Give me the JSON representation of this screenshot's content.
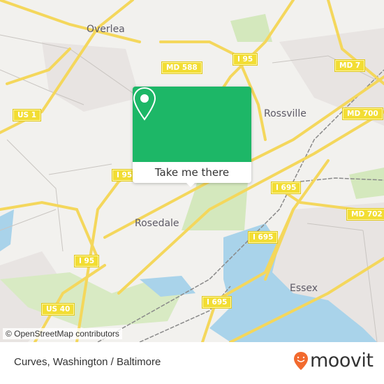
{
  "map": {
    "places": [
      {
        "name": "Overlea",
        "id": "overlea"
      },
      {
        "name": "Rossville",
        "id": "rossville"
      },
      {
        "name": "Rosedale",
        "id": "rosedale"
      },
      {
        "name": "Essex",
        "id": "essex"
      }
    ],
    "shields": [
      {
        "label": "MD 588",
        "id": "md-588"
      },
      {
        "label": "I 95",
        "id": "i-95-north"
      },
      {
        "label": "MD 7",
        "id": "md-7"
      },
      {
        "label": "US 1",
        "id": "us-1"
      },
      {
        "label": "MD 700",
        "id": "md-700"
      },
      {
        "label": "I 95",
        "id": "i-95-mid"
      },
      {
        "label": "I 695",
        "id": "i-695-east"
      },
      {
        "label": "MD 702",
        "id": "md-702"
      },
      {
        "label": "I 695",
        "id": "i-695-mid"
      },
      {
        "label": "I 95",
        "id": "i-95-south"
      },
      {
        "label": "US 40",
        "id": "us-40"
      },
      {
        "label": "I 695",
        "id": "i-695-south"
      }
    ],
    "attribution": "© OpenStreetMap contributors"
  },
  "popup": {
    "icon": "map-pin-icon",
    "button_label": "Take me there",
    "color": "#1db767"
  },
  "footer": {
    "title": "Curves, Washington / Baltimore",
    "brand": "moovit",
    "brand_color": "#f26a2e"
  }
}
